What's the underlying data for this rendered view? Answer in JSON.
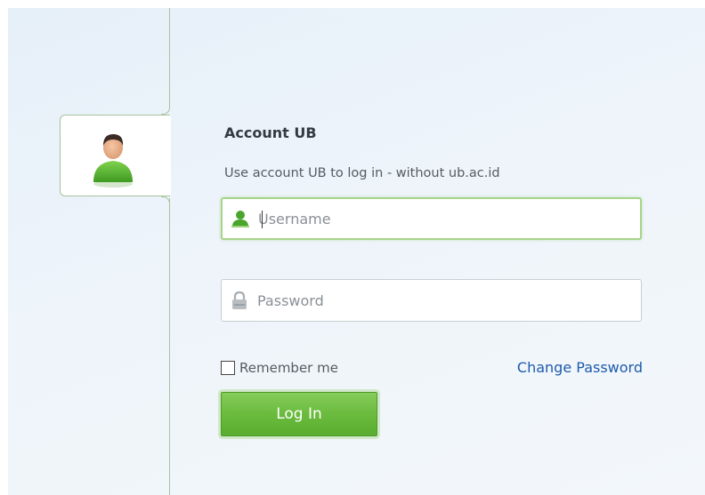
{
  "account": {
    "title": "Account UB",
    "subtitle": "Use account UB to log in - without ub.ac.id"
  },
  "form": {
    "username_placeholder": "Username",
    "username_value": "",
    "password_placeholder": "Password",
    "password_value": "",
    "remember_label": "Remember me",
    "remember_checked": false,
    "change_password_label": "Change Password",
    "login_label": "Log In"
  },
  "colors": {
    "accent_green": "#6abb3e",
    "link_blue": "#1e5bab",
    "focus_border": "#a8d48a"
  },
  "icons": {
    "tab": "user-avatar-icon",
    "username": "user-icon",
    "password": "lock-icon"
  }
}
